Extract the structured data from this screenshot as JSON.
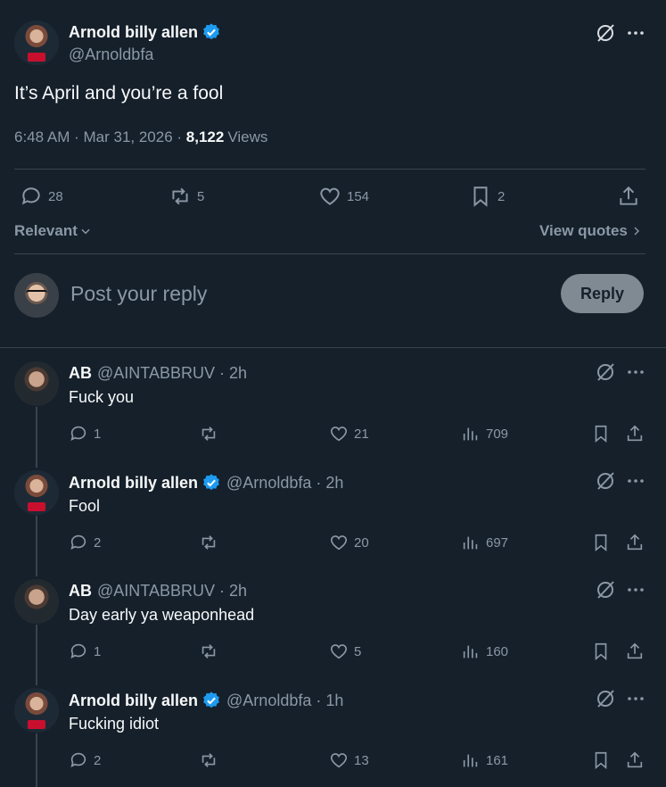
{
  "main_post": {
    "author_name": "Arnold billy allen",
    "author_handle": "@Arnoldbfa",
    "text": "It’s April and you’re a fool",
    "time": "6:48 AM",
    "date": "Mar 31, 2026",
    "views_count": "8,122",
    "views_label": "Views",
    "replies": "28",
    "reposts": "5",
    "likes": "154",
    "bookmarks": "2"
  },
  "sort": {
    "label": "Relevant",
    "view_quotes": "View quotes"
  },
  "compose": {
    "placeholder": "Post your reply",
    "reply_button": "Reply"
  },
  "replies": [
    {
      "name": "AB",
      "handle": "@AINTABBRUV",
      "time": "2h",
      "text": "Fuck you",
      "replies": "1",
      "likes": "21",
      "views": "709",
      "verified": false
    },
    {
      "name": "Arnold billy allen",
      "handle": "@Arnoldbfa",
      "time": "2h",
      "text": "Fool",
      "replies": "2",
      "likes": "20",
      "views": "697",
      "verified": true
    },
    {
      "name": "AB",
      "handle": "@AINTABBRUV",
      "time": "2h",
      "text": "Day early ya weaponhead",
      "replies": "1",
      "likes": "5",
      "views": "160",
      "verified": false
    },
    {
      "name": "Arnold billy allen",
      "handle": "@Arnoldbfa",
      "time": "1h",
      "text": "Fucking idiot",
      "replies": "2",
      "likes": "13",
      "views": "161",
      "verified": true
    }
  ],
  "colors": {
    "background": "#15202b",
    "verified": "#1d9bf0",
    "muted": "#8b98a5",
    "divider": "#38444d"
  }
}
